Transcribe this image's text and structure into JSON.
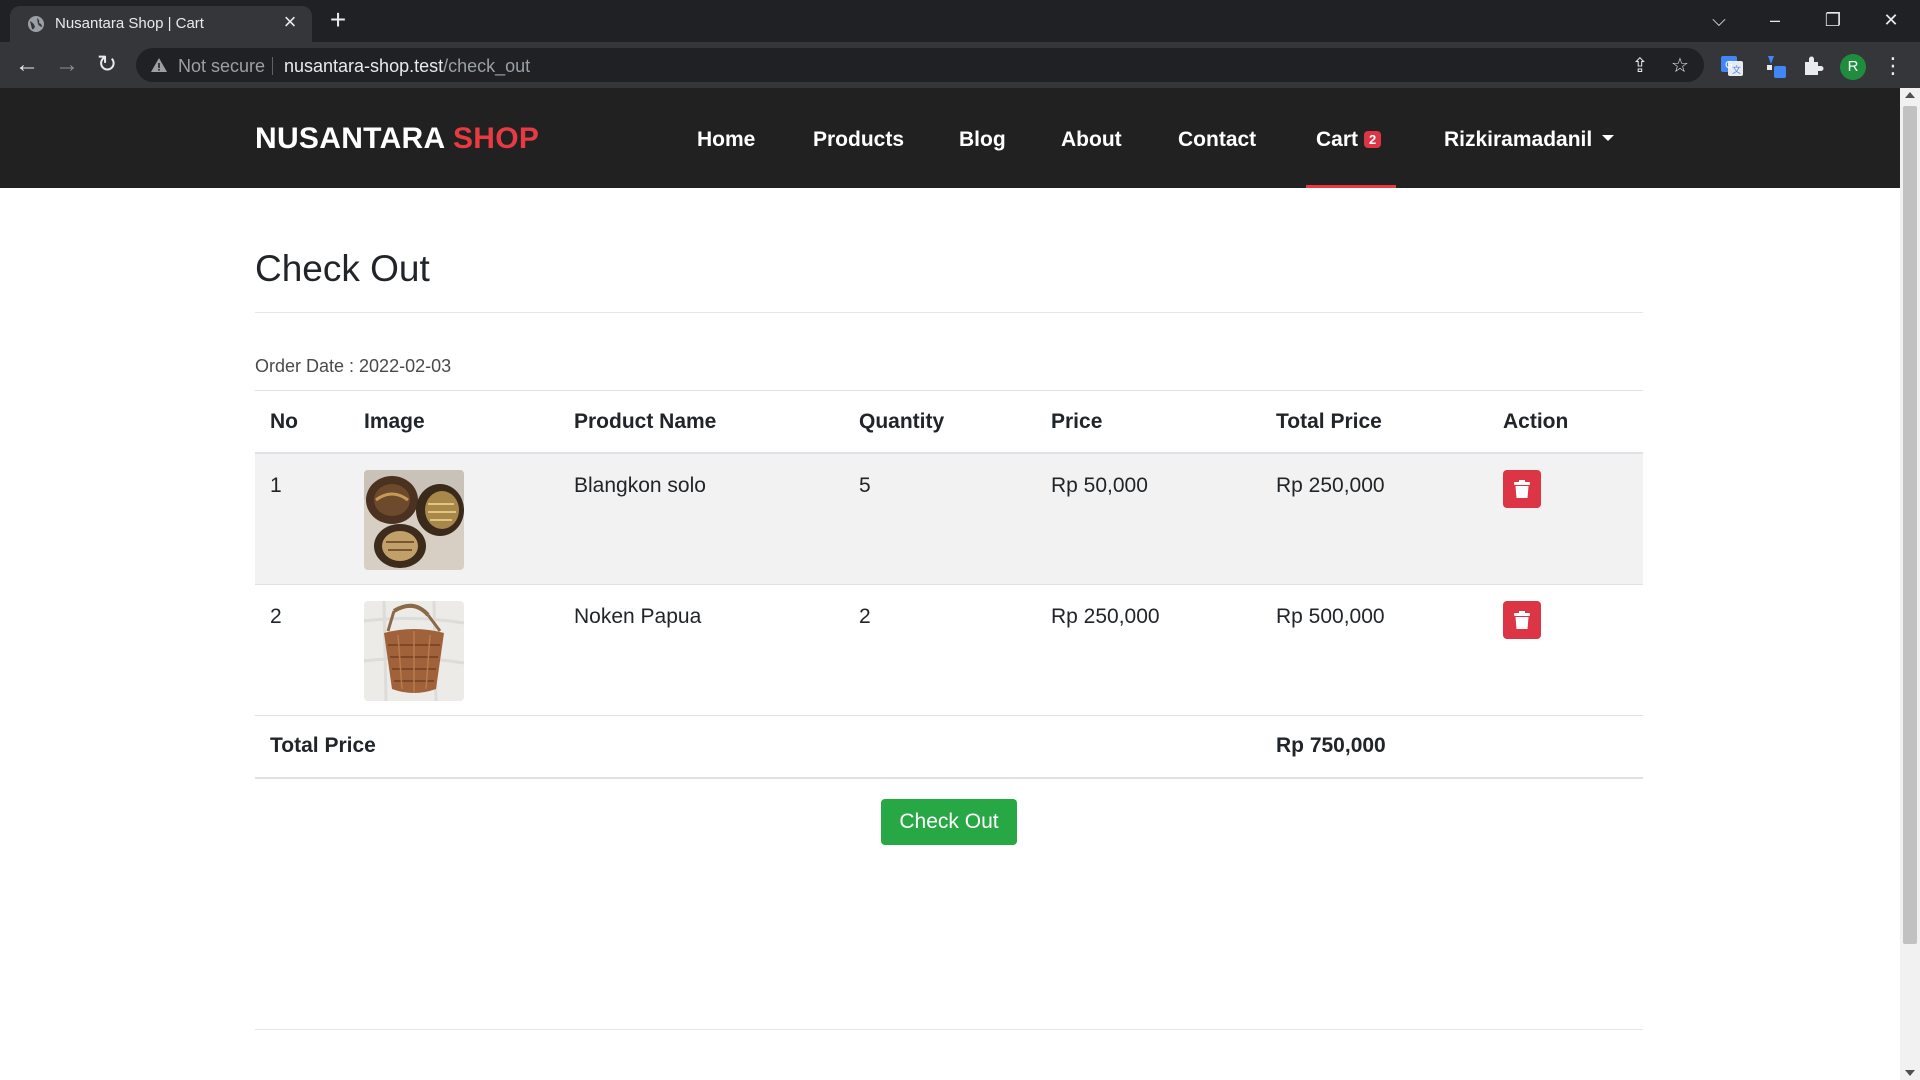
{
  "browser": {
    "tab_title": "Nusantara Shop | Cart",
    "security_label": "Not secure",
    "url_host": "nusantara-shop.test",
    "url_path": "/check_out",
    "profile_initial": "R"
  },
  "navbar": {
    "brand_part1": "NUSANTARA",
    "brand_part2": "SHOP",
    "links": [
      "Home",
      "Products",
      "Blog",
      "About",
      "Contact"
    ],
    "cart_label": "Cart",
    "cart_count": "2",
    "user_label": "Rizkiramadanil",
    "accent_color": "#e73a42"
  },
  "page": {
    "title": "Check Out",
    "order_date": "Order Date : 2022-02-03"
  },
  "table": {
    "headers": [
      "No",
      "Image",
      "Product Name",
      "Quantity",
      "Price",
      "Total Price",
      "Action"
    ],
    "rows": [
      {
        "no": "1",
        "image": "blangkon-solo-photo",
        "name": "Blangkon solo",
        "qty": "5",
        "price": "Rp 50,000",
        "total": "Rp 250,000"
      },
      {
        "no": "2",
        "image": "noken-papua-photo",
        "name": "Noken Papua",
        "qty": "2",
        "price": "Rp 250,000",
        "total": "Rp 500,000"
      }
    ],
    "total_label": "Total Price",
    "total_value": "Rp 750,000"
  },
  "actions": {
    "checkout_label": "Check Out",
    "delete_icon": "trash-icon",
    "checkout_color": "#28a745",
    "delete_color": "#dc3545"
  }
}
